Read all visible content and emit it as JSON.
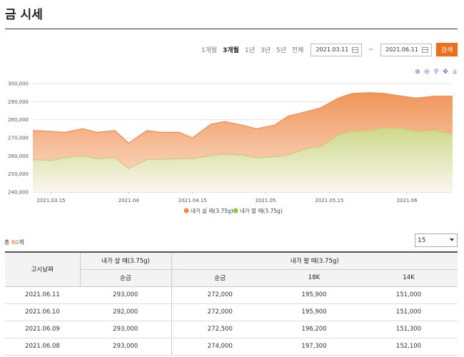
{
  "page": {
    "title": "금 시세"
  },
  "filters": {
    "periods": [
      "1개월",
      "3개월",
      "1년",
      "3년",
      "5년",
      "전체"
    ],
    "active_period_index": 1,
    "date_from": "2021.03.11",
    "date_sep": "~",
    "date_to": "2021.06.11",
    "search_label": "검색"
  },
  "chart_tools": [
    "zoom-in-icon",
    "zoom-out-icon",
    "magnify-icon",
    "pan-icon",
    "home-icon"
  ],
  "colors": {
    "accent": "#ef6e1d",
    "buy_series": "#f4a46a",
    "sell_series": "#d7e29a"
  },
  "chart_data": {
    "type": "area",
    "yticks": [
      "300,000",
      "290,000",
      "280,000",
      "270,000",
      "260,000",
      "250,000",
      "240,000"
    ],
    "ylim": [
      240000,
      300000
    ],
    "xticks": [
      "2021.03.15",
      "2021.04",
      "2021.04.15",
      "2021.05",
      "2021.05.15",
      "2021.06"
    ],
    "x": [
      "2021.03.11",
      "2021.03.15",
      "2021.03.18",
      "2021.03.22",
      "2021.03.25",
      "2021.03.29",
      "2021.04.01",
      "2021.04.05",
      "2021.04.08",
      "2021.04.12",
      "2021.04.15",
      "2021.04.19",
      "2021.04.22",
      "2021.04.26",
      "2021.04.29",
      "2021.05.03",
      "2021.05.06",
      "2021.05.10",
      "2021.05.13",
      "2021.05.17",
      "2021.05.20",
      "2021.05.24",
      "2021.05.27",
      "2021.05.31",
      "2021.06.03",
      "2021.06.07",
      "2021.06.11"
    ],
    "series": [
      {
        "name": "내가 살 때(3.75g)",
        "color": "#ef8a3c",
        "values": [
          274000,
          273500,
          273000,
          275000,
          273000,
          274000,
          267000,
          274000,
          273000,
          273000,
          270000,
          277500,
          279000,
          277000,
          275000,
          277000,
          282000,
          284500,
          286500,
          292000,
          294500,
          295000,
          294500,
          293000,
          292000,
          293000,
          293000
        ]
      },
      {
        "name": "내가 팔 때(3.75g)",
        "color": "#8cc63f",
        "values": [
          258000,
          257500,
          259000,
          260000,
          258500,
          259000,
          253000,
          258000,
          258000,
          258500,
          258500,
          260000,
          261000,
          260500,
          259000,
          259500,
          260500,
          264000,
          265000,
          271500,
          273500,
          274000,
          275500,
          275000,
          273500,
          274000,
          272000
        ]
      }
    ]
  },
  "table": {
    "total_prefix": "총 ",
    "total_count": "80",
    "total_suffix": "개",
    "page_size": "15",
    "headers": {
      "date": "고시날짜",
      "buy_group": "내가 살 때(3.75g)",
      "sell_group": "내가 팔 때(3.75g)",
      "buy_pure": "순금",
      "sell_pure": "순금",
      "k18": "18K",
      "k14": "14K"
    },
    "rows": [
      {
        "date": "2021.06.11",
        "buy_pure": "293,000",
        "sell_pure": "272,000",
        "k18": "195,900",
        "k14": "151,000"
      },
      {
        "date": "2021.06.10",
        "buy_pure": "292,000",
        "sell_pure": "272,000",
        "k18": "195,900",
        "k14": "151,000"
      },
      {
        "date": "2021.06.09",
        "buy_pure": "293,000",
        "sell_pure": "272,500",
        "k18": "196,200",
        "k14": "151,300"
      },
      {
        "date": "2021.06.08",
        "buy_pure": "293,000",
        "sell_pure": "274,000",
        "k18": "197,300",
        "k14": "152,100"
      }
    ]
  }
}
